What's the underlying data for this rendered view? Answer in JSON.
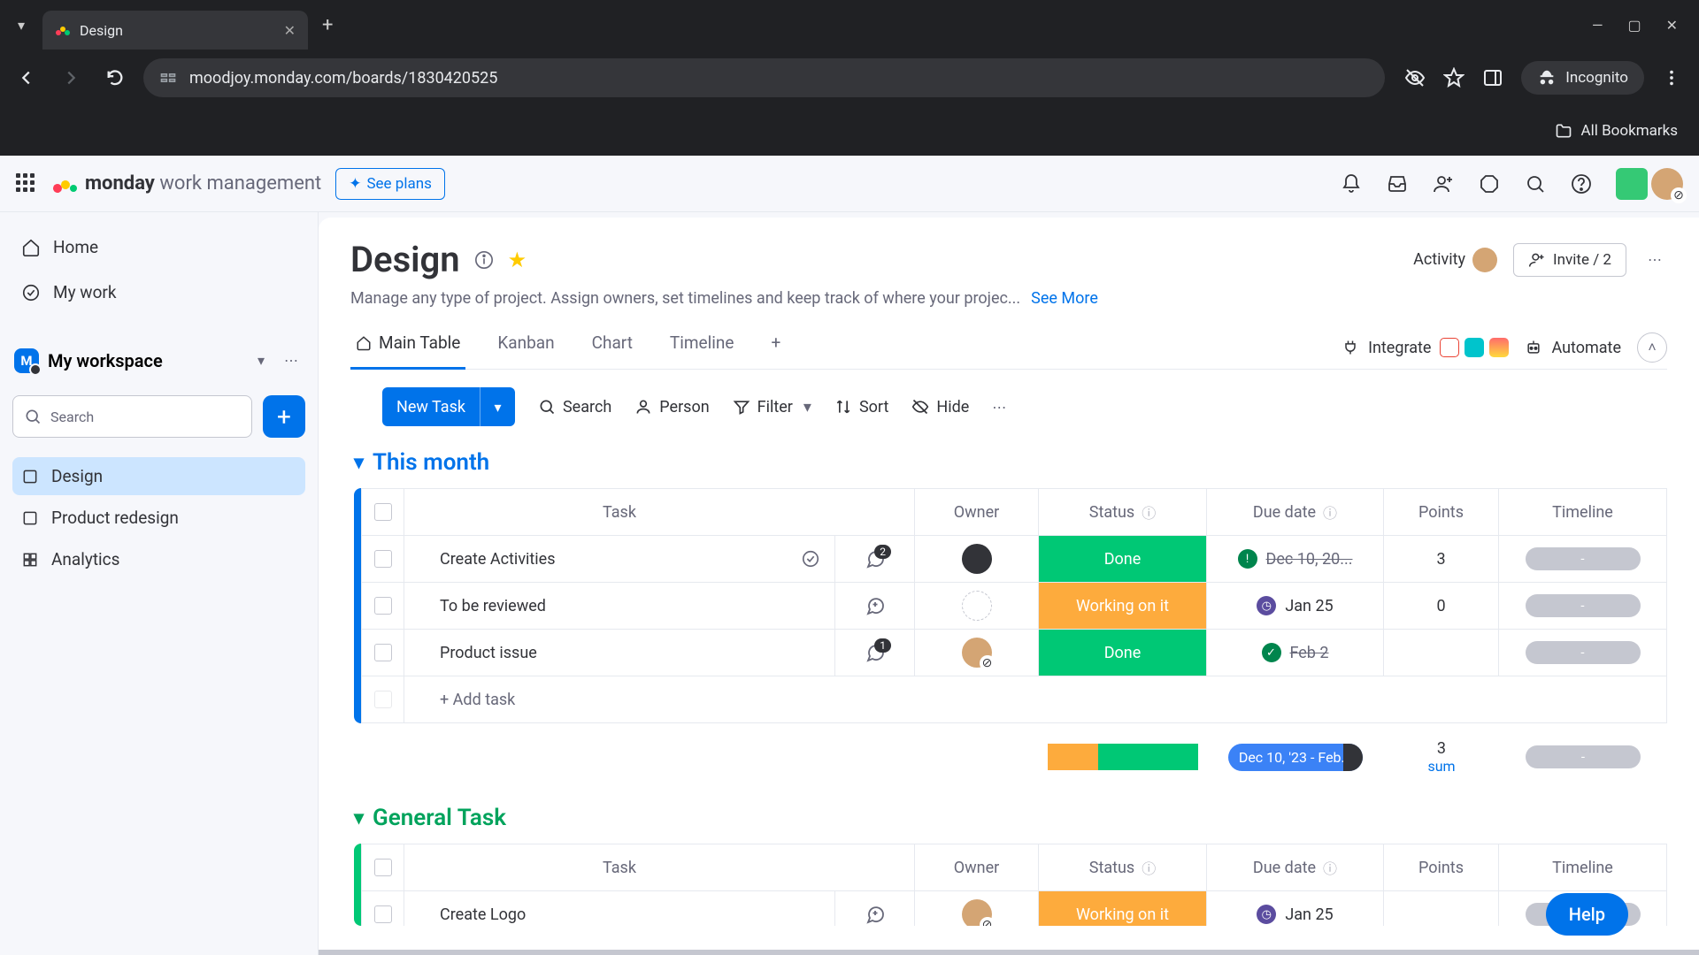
{
  "browser": {
    "tab_title": "Design",
    "url": "moodjoy.monday.com/boards/1830420525",
    "incognito_label": "Incognito",
    "all_bookmarks": "All Bookmarks"
  },
  "topbar": {
    "brand_bold": "monday",
    "brand_light": "work management",
    "see_plans": "See plans"
  },
  "sidebar": {
    "home": "Home",
    "my_work": "My work",
    "workspace_name": "My workspace",
    "workspace_initial": "M",
    "search_placeholder": "Search",
    "items": [
      {
        "label": "Design",
        "active": true,
        "icon": "board"
      },
      {
        "label": "Product redesign",
        "active": false,
        "icon": "board"
      },
      {
        "label": "Analytics",
        "active": false,
        "icon": "dashboard"
      }
    ]
  },
  "board": {
    "title": "Design",
    "description": "Manage any type of project. Assign owners, set timelines and keep track of where your projec...",
    "see_more": "See More",
    "activity_label": "Activity",
    "invite_label": "Invite / 2",
    "tabs": [
      {
        "label": "Main Table",
        "active": true,
        "icon": "home"
      },
      {
        "label": "Kanban",
        "active": false
      },
      {
        "label": "Chart",
        "active": false
      },
      {
        "label": "Timeline",
        "active": false
      }
    ],
    "integrate_label": "Integrate",
    "automate_label": "Automate",
    "toolbar": {
      "new_task": "New Task",
      "search": "Search",
      "person": "Person",
      "filter": "Filter",
      "sort": "Sort",
      "hide": "Hide"
    },
    "columns": {
      "task": "Task",
      "owner": "Owner",
      "status": "Status",
      "due": "Due date",
      "points": "Points",
      "timeline": "Timeline"
    },
    "groups": [
      {
        "name": "This month",
        "color": "blue",
        "rows": [
          {
            "task": "Create Activities",
            "hasCheck": true,
            "conv": 2,
            "owner": "black",
            "status": "Done",
            "statusClass": "done",
            "dueIcon": "warn",
            "due": "Dec 10, 20...",
            "dueStrike": true,
            "points": "3",
            "timeline": "-"
          },
          {
            "task": "To be reviewed",
            "conv": null,
            "convAdd": true,
            "owner": "empty",
            "status": "Working on it",
            "statusClass": "working",
            "dueIcon": "clock",
            "due": "Jan 25",
            "dueStrike": false,
            "points": "0",
            "timeline": "-"
          },
          {
            "task": "Product issue",
            "conv": 1,
            "owner": "photo",
            "status": "Done",
            "statusClass": "done",
            "dueIcon": "ok",
            "due": "Feb 2",
            "dueStrike": true,
            "points": "",
            "timeline": "-"
          }
        ],
        "add_task": "+ Add task",
        "summary": {
          "date_range": "Dec 10, '23 - Feb...",
          "points_value": "3",
          "points_label": "sum",
          "timeline": "-"
        }
      },
      {
        "name": "General Task",
        "color": "green",
        "rows": [
          {
            "task": "Create Logo",
            "convAdd": true,
            "owner": "photo",
            "status": "Working on it",
            "statusClass": "working",
            "dueIcon": "clock",
            "due": "Jan 25",
            "points": "",
            "timeline": "-"
          }
        ]
      }
    ]
  },
  "help": "Help"
}
